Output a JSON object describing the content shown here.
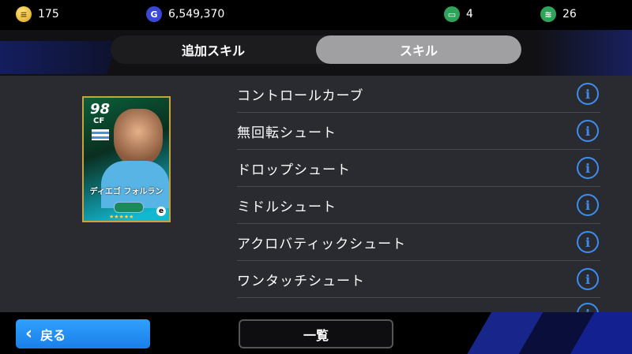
{
  "currencies": {
    "coins": "175",
    "gp": "6,549,370",
    "ticket_a": "4",
    "ticket_b": "26"
  },
  "tabs": [
    {
      "label": "追加スキル",
      "active": false
    },
    {
      "label": "スキル",
      "active": true
    }
  ],
  "card": {
    "rating": "98",
    "position": "CF",
    "player_name": "ディエゴ フォルラン"
  },
  "skills": [
    "コントロールカーブ",
    "無回転シュート",
    "ドロップシュート",
    "ミドルシュート",
    "アクロバティックシュート",
    "ワンタッチシュート"
  ],
  "footer": {
    "back_label": "戻る",
    "list_label": "一覧"
  },
  "colors": {
    "accent_blue": "#1a7fe8",
    "info_icon": "#3d8df0",
    "active_tab": "#a0a0a3"
  }
}
